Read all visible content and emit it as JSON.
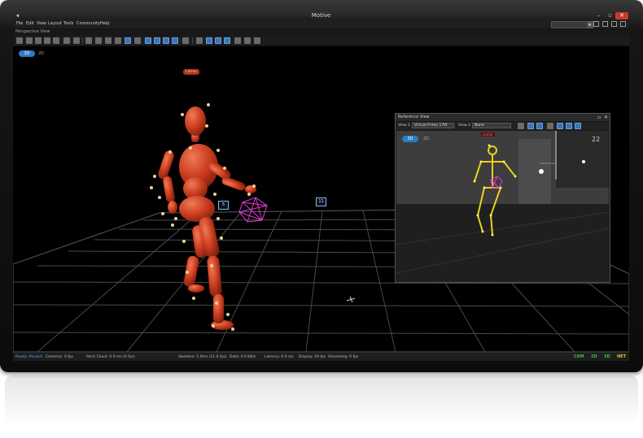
{
  "window": {
    "title": "Motive",
    "minimize": "–",
    "maximize": "▫",
    "close": "✕"
  },
  "menu": [
    "File",
    "Edit",
    "View",
    "Layout",
    "Tools",
    "Community",
    "Help"
  ],
  "perspective_view": {
    "title": "Perspective View"
  },
  "viewport": {
    "mode_3d": "3D",
    "mode_2d": "2D",
    "asset_label": "Lamar"
  },
  "reference_view": {
    "title": "Reference View",
    "view1_label": "View 1",
    "view1_value": "Virtual Prime 17W",
    "view2_label": "View 2",
    "view2_value": "None",
    "mode_3d": "3D",
    "mode_2d": "2D",
    "frame_count": "22",
    "marker_label": "Lamar"
  },
  "camera_labels": {
    "cam_a": "5",
    "cam_b": "11"
  },
  "status": {
    "state": "Ready: Paused",
    "cameras": "Cameras: 0 fps",
    "pointcloud": "Point Cloud: 0.0 ms (0 fps)",
    "skeleton": "Skeleton: 1.0ms (11.0 fps)",
    "data": "Data: 0.0 KB/s",
    "latency": "Latency: 0.0 ms",
    "display": "Display: 59 fps",
    "streaming": "Streaming: 0 fps",
    "indicators": [
      "CAM",
      "2D",
      "3D",
      "NET"
    ]
  },
  "colors": {
    "accent": "#2d7bc2",
    "skeleton_orange": "#d4462a",
    "marker_yellow": "#e8d21a",
    "rigid_body_magenta": "#e03cd4",
    "indicator_green": "#3cc43c",
    "indicator_yellow": "#e6c01e"
  }
}
